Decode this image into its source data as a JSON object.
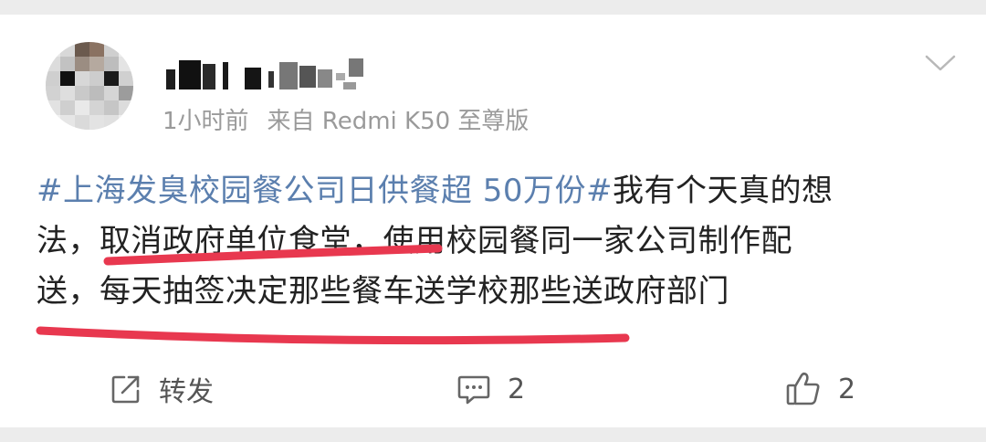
{
  "post": {
    "username_redacted": true,
    "meta": {
      "time": "1小时前",
      "source": "来自 Redmi K50 至尊版"
    },
    "content": {
      "hashtag": "#上海发臭校园餐公司日供餐超 50万份#",
      "line1_rest": "我有个天真的想",
      "line2": "法，取消政府单位食堂，使用校园餐同一家公司制作配",
      "line3": "送，每天抽签决定那些餐车送学校那些送政府部门"
    },
    "actions": {
      "repost_label": "转发",
      "comment_count": "2",
      "like_count": "2"
    }
  },
  "icons": {
    "expand": "chevron-down-icon",
    "repost": "share-icon",
    "comment": "comment-icon",
    "like": "thumbs-up-icon"
  },
  "colors": {
    "hashtag": "#5b7fae",
    "text": "#222222",
    "meta": "#9a9a9a",
    "annotation_underline": "#e8384f"
  }
}
